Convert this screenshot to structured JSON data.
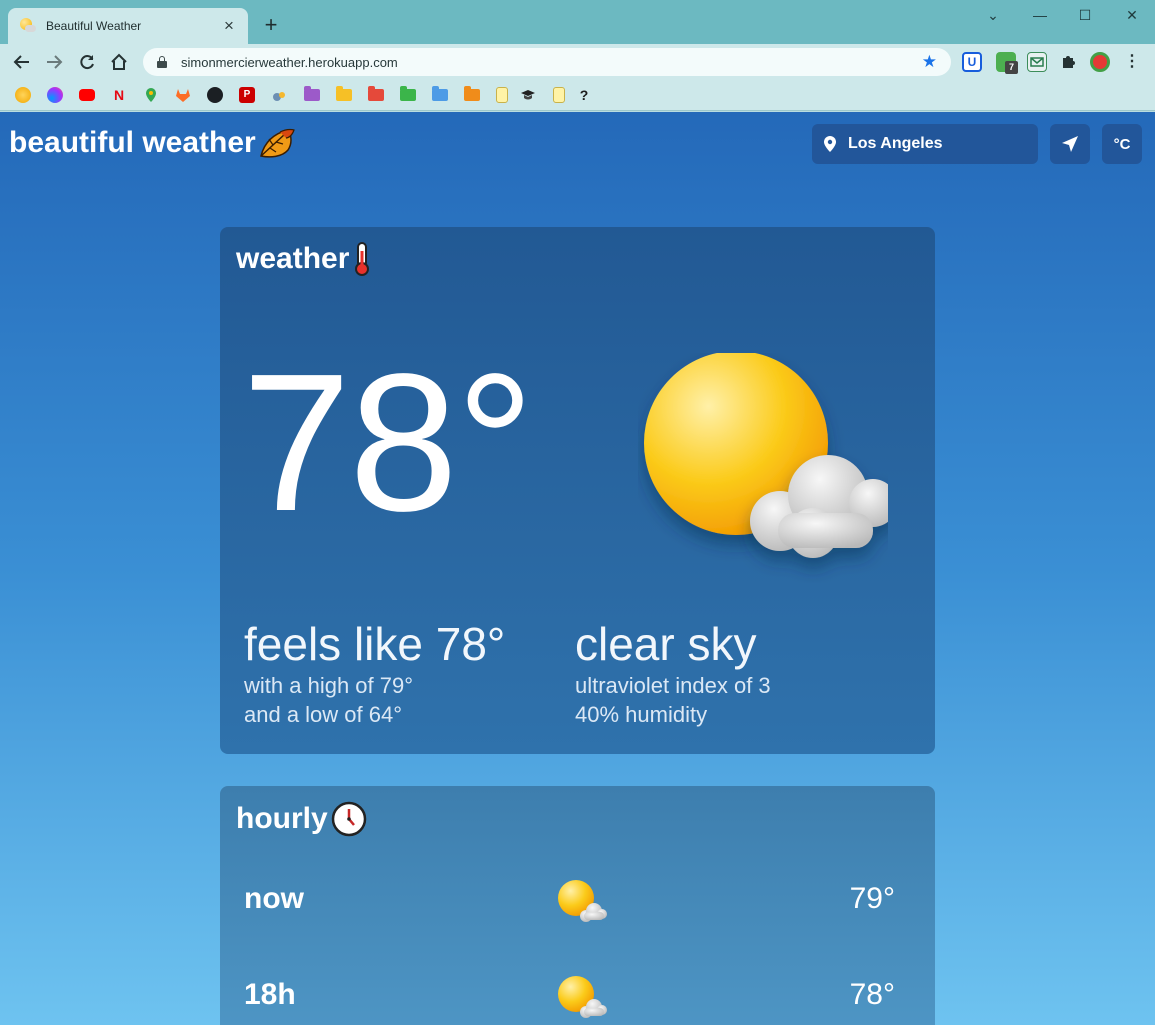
{
  "browser": {
    "tab_title": "Beautiful Weather",
    "tab_close": "×",
    "new_tab": "+",
    "url": "simonmercierweather.herokuapp.com",
    "minimize": "—",
    "maximize": "☐",
    "close": "✕",
    "tab_search": "⌄",
    "extension_badge": "7",
    "bookmark_letters": {
      "netflix": "N",
      "pinterest": "P",
      "question": "?"
    }
  },
  "app": {
    "title": "beautiful weather",
    "title_icon": "maple-leaf-icon",
    "location": "Los Angeles",
    "unit_label": "°C"
  },
  "current": {
    "title": "weather",
    "title_icon": "thermometer-icon",
    "temperature": "78°",
    "icon": "sun-behind-cloud-icon",
    "feels_like": "feels like 78°",
    "high": "with a high of 79°",
    "low": "and a low of 64°",
    "condition": "clear sky",
    "uv": "ultraviolet index of 3",
    "humidity": "40% humidity"
  },
  "hourly": {
    "title": "hourly",
    "title_icon": "clock-icon",
    "rows": [
      {
        "label": "now",
        "icon": "sun-behind-cloud-icon",
        "temp": "79°"
      },
      {
        "label": "18h",
        "icon": "sun-behind-cloud-icon",
        "temp": "78°"
      }
    ]
  },
  "colors": {
    "accent": "#1a73e8",
    "page_top": "#2469b9",
    "page_bottom": "#6ec3f0",
    "sun": "#f7b500"
  }
}
